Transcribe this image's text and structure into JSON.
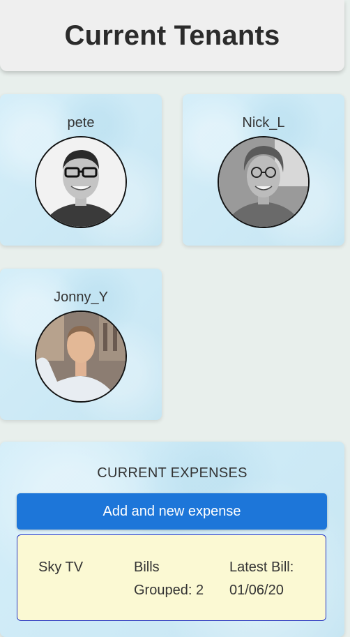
{
  "header": {
    "title": "Current Tenants"
  },
  "tenants": [
    {
      "name": "pete",
      "avatar_icon": "person-photo-icon"
    },
    {
      "name": "Nick_L",
      "avatar_icon": "person-photo-icon"
    },
    {
      "name": "Jonny_Y",
      "avatar_icon": "person-photo-icon"
    }
  ],
  "expenses": {
    "title": "CURRENT EXPENSES",
    "add_button_label": "Add and new expense",
    "items": [
      {
        "name": "Sky TV",
        "bills_label": "Bills",
        "grouped_label": "Grouped: 2",
        "latest_label": "Latest Bill:",
        "latest_date": "01/06/20"
      }
    ]
  },
  "colors": {
    "background": "#e8efec",
    "card": "#cdeaf6",
    "button": "#1d76d9",
    "expense_item": "#fbf9d3",
    "expense_border": "#2636c4"
  }
}
